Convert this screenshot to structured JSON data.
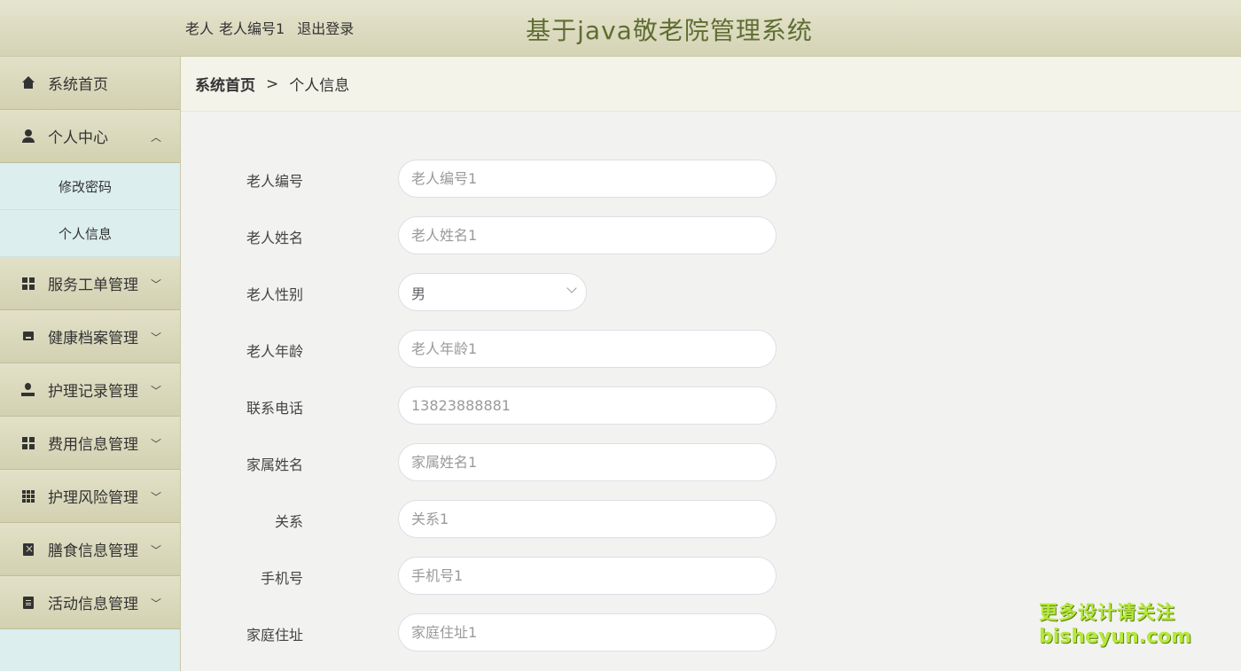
{
  "header": {
    "user_role": "老人",
    "user_name": "老人编号1",
    "logout_label": "退出登录",
    "title": "基于java敬老院管理系统"
  },
  "sidebar": {
    "items": [
      {
        "label": "系统首页",
        "icon": "home-icon"
      },
      {
        "label": "个人中心",
        "icon": "user-icon",
        "expanded": true,
        "children": [
          {
            "label": "修改密码"
          },
          {
            "label": "个人信息"
          }
        ]
      },
      {
        "label": "服务工单管理",
        "icon": "grid-icon"
      },
      {
        "label": "健康档案管理",
        "icon": "box-icon"
      },
      {
        "label": "护理记录管理",
        "icon": "person-icon"
      },
      {
        "label": "费用信息管理",
        "icon": "grid-icon"
      },
      {
        "label": "护理风险管理",
        "icon": "grid9-icon"
      },
      {
        "label": "膳食信息管理",
        "icon": "clipboard-x-icon"
      },
      {
        "label": "活动信息管理",
        "icon": "clipboard-icon"
      }
    ]
  },
  "breadcrumb": {
    "home": "系统首页",
    "separator": ">",
    "current": "个人信息"
  },
  "form": {
    "fields": [
      {
        "label": "老人编号",
        "placeholder": "老人编号1"
      },
      {
        "label": "老人姓名",
        "placeholder": "老人姓名1"
      },
      {
        "label": "老人性别",
        "value": "男"
      },
      {
        "label": "老人年龄",
        "placeholder": "老人年龄1"
      },
      {
        "label": "联系电话",
        "placeholder": "13823888881"
      },
      {
        "label": "家属姓名",
        "placeholder": "家属姓名1"
      },
      {
        "label": "关系",
        "placeholder": "关系1"
      },
      {
        "label": "手机号",
        "placeholder": "手机号1"
      },
      {
        "label": "家庭住址",
        "placeholder": "家庭住址1"
      }
    ]
  },
  "watermark": {
    "line1": "更多设计请关注",
    "line2": "bisheyun.com"
  }
}
